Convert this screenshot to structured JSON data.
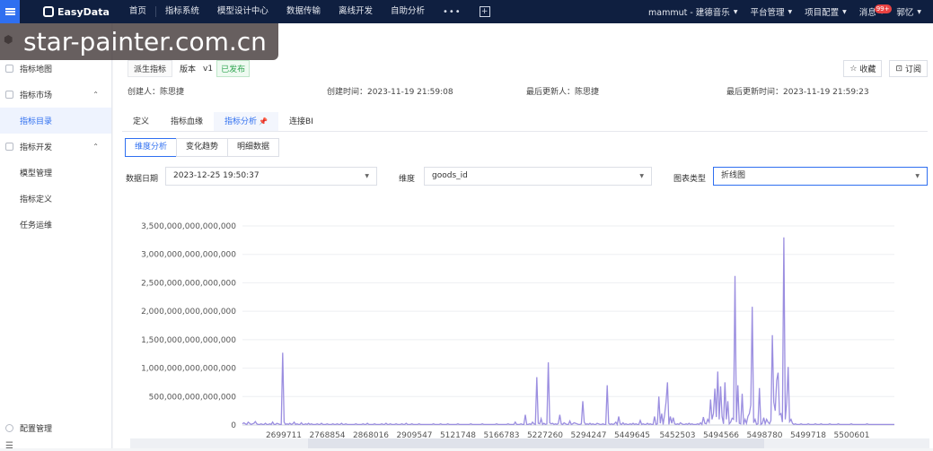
{
  "topbar": {
    "logo": "EasyData",
    "nav": [
      "首页",
      "指标系统",
      "模型设计中心",
      "数据传输",
      "离线开发",
      "自助分析"
    ],
    "more": "•••",
    "plus": "+",
    "right": {
      "tenant": "mammut - 建德音乐",
      "platform": "平台管理",
      "project": "项目配置",
      "messages": "消息",
      "badge": "99+",
      "user": "郭忆"
    }
  },
  "watermark": "star-painter.com.cn",
  "sidebar": {
    "items": [
      {
        "label": "指标地图",
        "type": "group"
      },
      {
        "label": "指标市场",
        "type": "group",
        "arrow": "⌃"
      },
      {
        "label": "指标目录",
        "type": "item",
        "active": true
      },
      {
        "label": "指标开发",
        "type": "group",
        "arrow": "⌃"
      },
      {
        "label": "模型管理",
        "type": "item"
      },
      {
        "label": "指标定义",
        "type": "item"
      },
      {
        "label": "任务运维",
        "type": "item"
      }
    ],
    "bottom": "配置管理",
    "foot": "☰"
  },
  "header": {
    "type_tag": "派生指标",
    "version_label": "版本",
    "version": "v1",
    "status": "已发布",
    "favorite": "收藏",
    "subscribe": "订阅",
    "creator": "创建人：陈思捷",
    "created": "创建时间：2023-11-19 21:59:08",
    "updater": "最后更新人：陈思捷",
    "updated": "最后更新时间：2023-11-19 21:59:23"
  },
  "tabs": [
    "定义",
    "指标血缘",
    "指标分析",
    "连接BI"
  ],
  "subtabs": [
    "维度分析",
    "变化趋势",
    "明细数据"
  ],
  "filters": {
    "date_label": "数据日期",
    "date_value": "2023-12-25 19:50:37",
    "dim_label": "维度",
    "dim_value": "goods_id",
    "chart_label": "图表类型",
    "chart_value": "折线图"
  },
  "chart_data": {
    "type": "line",
    "ylim": [
      0,
      3500000000000000
    ],
    "yticks": [
      "0",
      "500,000,000,000,000",
      "1,000,000,000,000,000",
      "1,500,000,000,000,000",
      "2,000,000,000,000,000",
      "2,500,000,000,000,000",
      "3,000,000,000,000,000",
      "3,500,000,000,000,000"
    ],
    "xticks": [
      "2699711",
      "2768854",
      "2868016",
      "2909547",
      "5121748",
      "5166783",
      "5227260",
      "5294247",
      "5449645",
      "5452503",
      "5494566",
      "5498780",
      "5499718",
      "5500601"
    ],
    "color": "#9b8ee0",
    "values": [
      20000000000000.0,
      40000000000000.0,
      20000000000000.0,
      10000000000000.0,
      50000000000000.0,
      30000000000000.0,
      10000000000000.0,
      20000000000000.0,
      30000000000000.0,
      60000000000000.0,
      20000000000000.0,
      10000000000000.0,
      10000000000000.0,
      20000000000000.0,
      10000000000000.0,
      10000000000000.0,
      30000000000000.0,
      10000000000000.0,
      10000000000000.0,
      20000000000000.0,
      10000000000000.0,
      50000000000000.0,
      10000000000000.0,
      10000000000000.0,
      30000000000000.0,
      20000000000000.0,
      10000000000000.0,
      10000000000000.0,
      1270000000000000.0,
      50000000000000.0,
      10000000000000.0,
      20000000000000.0,
      10000000000000.0,
      30000000000000.0,
      10000000000000.0,
      20000000000000.0,
      50000000000000.0,
      10000000000000.0,
      20000000000000.0,
      10000000000000.0,
      10000000000000.0,
      40000000000000.0,
      10000000000000.0,
      10000000000000.0,
      20000000000000.0,
      10000000000000.0,
      30000000000000.0,
      10000000000000.0,
      20000000000000.0,
      10000000000000.0,
      10000000000000.0,
      10000000000000.0,
      20000000000000.0,
      10000000000000.0,
      10000000000000.0,
      30000000000000.0,
      10000000000000.0,
      10000000000000.0,
      10000000000000.0,
      20000000000000.0,
      10000000000000.0,
      10000000000000.0,
      10000000000000.0,
      20000000000000.0,
      10000000000000.0,
      10000000000000.0,
      20000000000000.0,
      10000000000000.0,
      10000000000000.0,
      30000000000000.0,
      10000000000000.0,
      10000000000000.0,
      20000000000000.0,
      10000000000000.0,
      10000000000000.0,
      10000000000000.0,
      10000000000000.0,
      10000000000000.0,
      10000000000000.0,
      20000000000000.0,
      10000000000000.0,
      10000000000000.0,
      10000000000000.0,
      10000000000000.0,
      20000000000000.0,
      10000000000000.0,
      10000000000000.0,
      30000000000000.0,
      10000000000000.0,
      10000000000000.0,
      10000000000000.0,
      10000000000000.0,
      20000000000000.0,
      10000000000000.0,
      10000000000000.0,
      10000000000000.0,
      10000000000000.0,
      20000000000000.0,
      10000000000000.0,
      10000000000000.0,
      30000000000000.0,
      10000000000000.0,
      10000000000000.0,
      20000000000000.0,
      10000000000000.0,
      10000000000000.0,
      10000000000000.0,
      20000000000000.0,
      10000000000000.0,
      10000000000000.0,
      10000000000000.0,
      20000000000000.0,
      10000000000000.0,
      10000000000000.0,
      30000000000000.0,
      10000000000000.0,
      10000000000000.0,
      10000000000000.0,
      20000000000000.0,
      10000000000000.0,
      10000000000000.0,
      10000000000000.0,
      10000000000000.0,
      20000000000000.0,
      10000000000000.0,
      10000000000000.0,
      10000000000000.0,
      10000000000000.0,
      10000000000000.0,
      10000000000000.0,
      10000000000000.0,
      10000000000000.0,
      10000000000000.0,
      20000000000000.0,
      10000000000000.0,
      10000000000000.0,
      10000000000000.0,
      10000000000000.0,
      20000000000000.0,
      10000000000000.0,
      10000000000000.0,
      10000000000000.0,
      10000000000000.0,
      20000000000000.0,
      10000000000000.0,
      10000000000000.0,
      10000000000000.0,
      10000000000000.0,
      10000000000000.0,
      10000000000000.0,
      20000000000000.0,
      10000000000000.0,
      10000000000000.0,
      10000000000000.0,
      10000000000000.0,
      10000000000000.0,
      10000000000000.0,
      10000000000000.0,
      10000000000000.0,
      20000000000000.0,
      10000000000000.0,
      10000000000000.0,
      10000000000000.0,
      10000000000000.0,
      10000000000000.0,
      10000000000000.0,
      10000000000000.0,
      20000000000000.0,
      10000000000000.0,
      10000000000000.0,
      10000000000000.0,
      10000000000000.0,
      10000000000000.0,
      10000000000000.0,
      10000000000000.0,
      10000000000000.0,
      10000000000000.0,
      20000000000000.0,
      10000000000000.0,
      10000000000000.0,
      10000000000000.0,
      10000000000000.0,
      10000000000000.0,
      10000000000000.0,
      10000000000000.0,
      20000000000000.0,
      10000000000000.0,
      10000000000000.0,
      10000000000000.0,
      10000000000000.0,
      50000000000000.0,
      10000000000000.0,
      10000000000000.0,
      10000000000000.0,
      20000000000000.0,
      10000000000000.0,
      10000000000000.0,
      180000000000000.0,
      10000000000000.0,
      10000000000000.0,
      20000000000000.0,
      10000000000000.0,
      50000000000000.0,
      20000000000000.0,
      10000000000000.0,
      840000000000000.0,
      30000000000000.0,
      20000000000000.0,
      110000000000000.0,
      10000000000000.0,
      30000000000000.0,
      10000000000000.0,
      20000000000000.0,
      1100000000000000.0,
      40000000000000.0,
      20000000000000.0,
      30000000000000.0,
      10000000000000.0,
      20000000000000.0,
      10000000000000.0,
      30000000000000.0,
      180000000000000.0,
      20000000000000.0,
      10000000000000.0,
      40000000000000.0,
      20000000000000.0,
      10000000000000.0,
      10000000000000.0,
      70000000000000.0,
      10000000000000.0,
      20000000000000.0,
      40000000000000.0,
      30000000000000.0,
      20000000000000.0,
      10000000000000.0,
      10000000000000.0,
      20000000000000.0,
      420000000000000.0,
      50000000000000.0,
      10000000000000.0,
      20000000000000.0,
      10000000000000.0,
      30000000000000.0,
      10000000000000.0,
      20000000000000.0,
      10000000000000.0,
      10000000000000.0,
      30000000000000.0,
      20000000000000.0,
      10000000000000.0,
      10000000000000.0,
      20000000000000.0,
      10000000000000.0,
      10000000000000.0,
      700000000000000.0,
      30000000000000.0,
      10000000000000.0,
      20000000000000.0,
      10000000000000.0,
      20000000000000.0,
      50000000000000.0,
      10000000000000.0,
      150000000000000.0,
      20000000000000.0,
      10000000000000.0,
      40000000000000.0,
      10000000000000.0,
      20000000000000.0,
      10000000000000.0,
      10000000000000.0,
      20000000000000.0,
      10000000000000.0,
      30000000000000.0,
      10000000000000.0,
      20000000000000.0,
      10000000000000.0,
      10000000000000.0,
      80000000000000.0,
      10000000000000.0,
      20000000000000.0,
      10000000000000.0,
      10000000000000.0,
      30000000000000.0,
      10000000000000.0,
      20000000000000.0,
      10000000000000.0,
      10000000000000.0,
      150000000000000.0,
      10000000000000.0,
      20000000000000.0,
      500000000000000.0,
      30000000000000.0,
      200000000000000.0,
      10000000000000.0,
      180000000000000.0,
      400000000000000.0,
      750000000000000.0,
      10000000000000.0,
      150000000000000.0,
      30000000000000.0,
      130000000000000.0,
      20000000000000.0,
      10000000000000.0,
      20000000000000.0,
      10000000000000.0,
      40000000000000.0,
      20000000000000.0,
      10000000000000.0,
      10000000000000.0,
      20000000000000.0,
      10000000000000.0,
      30000000000000.0,
      10000000000000.0,
      20000000000000.0,
      10000000000000.0,
      10000000000000.0,
      10000000000000.0,
      20000000000000.0,
      10000000000000.0,
      40000000000000.0,
      10000000000000.0,
      140000000000000.0,
      30000000000000.0,
      20000000000000.0,
      100000000000000.0,
      50000000000000.0,
      450000000000000.0,
      100000000000000.0,
      200000000000000.0,
      640000000000000.0,
      140000000000000.0,
      940000000000000.0,
      100000000000000.0,
      680000000000000.0,
      150000000000000.0,
      20000000000000.0,
      750000000000000.0,
      100000000000000.0,
      420000000000000.0,
      20000000000000.0,
      50000000000000.0,
      120000000000000.0,
      100000000000000.0,
      2620000000000000.0,
      50000000000000.0,
      700000000000000.0,
      30000000000000.0,
      20000000000000.0,
      550000000000000.0,
      10000000000000.0,
      100000000000000.0,
      30000000000000.0,
      150000000000000.0,
      200000000000000.0,
      350000000000000.0,
      2080000000000000.0,
      40000000000000.0,
      100000000000000.0,
      10000000000000.0,
      20000000000000.0,
      650000000000000.0,
      10000000000000.0,
      30000000000000.0,
      130000000000000.0,
      20000000000000.0,
      100000000000000.0,
      50000000000000.0,
      20000000000000.0,
      80000000000000.0,
      1580000000000000.0,
      400000000000000.0,
      250000000000000.0,
      780000000000000.0,
      920000000000000.0,
      180000000000000.0,
      200000000000000.0,
      50000000000000.0,
      3300000000000000.0,
      100000000000000.0,
      400000000000000.0,
      1020000000000000.0,
      60000000000000.0,
      100000000000000.0,
      30000000000000.0,
      10000000000000.0,
      20000000000000.0,
      10000000000000.0,
      10000000000000.0,
      10000000000000.0,
      20000000000000.0,
      10000000000000.0,
      10000000000000.0,
      10000000000000.0,
      10000000000000.0,
      20000000000000.0,
      10000000000000.0,
      10000000000000.0,
      10000000000000.0,
      10000000000000.0,
      20000000000000.0,
      10000000000000.0,
      10000000000000.0,
      10000000000000.0,
      20000000000000.0,
      10000000000000.0,
      10000000000000.0,
      10000000000000.0,
      10000000000000.0,
      10000000000000.0,
      20000000000000.0,
      10000000000000.0,
      10000000000000.0,
      10000000000000.0,
      10000000000000.0,
      10000000000000.0,
      20000000000000.0,
      10000000000000.0,
      10000000000000.0,
      10000000000000.0,
      10000000000000.0,
      10000000000000.0,
      10000000000000.0,
      10000000000000.0,
      10000000000000.0,
      20000000000000.0,
      10000000000000.0,
      10000000000000.0,
      10000000000000.0,
      10000000000000.0,
      10000000000000.0,
      10000000000000.0,
      10000000000000.0,
      10000000000000.0,
      10000000000000.0,
      10000000000000.0,
      20000000000000.0,
      10000000000000.0,
      10000000000000.0,
      10000000000000.0,
      10000000000000.0,
      10000000000000.0,
      10000000000000.0,
      10000000000000.0,
      10000000000000.0,
      10000000000000.0,
      10000000000000.0,
      10000000000000.0,
      10000000000000.0,
      10000000000000.0,
      10000000000000.0,
      10000000000000.0,
      10000000000000.0,
      10000000000000.0,
      10000000000000.0,
      10000000000000.0
    ],
    "grid": true
  }
}
